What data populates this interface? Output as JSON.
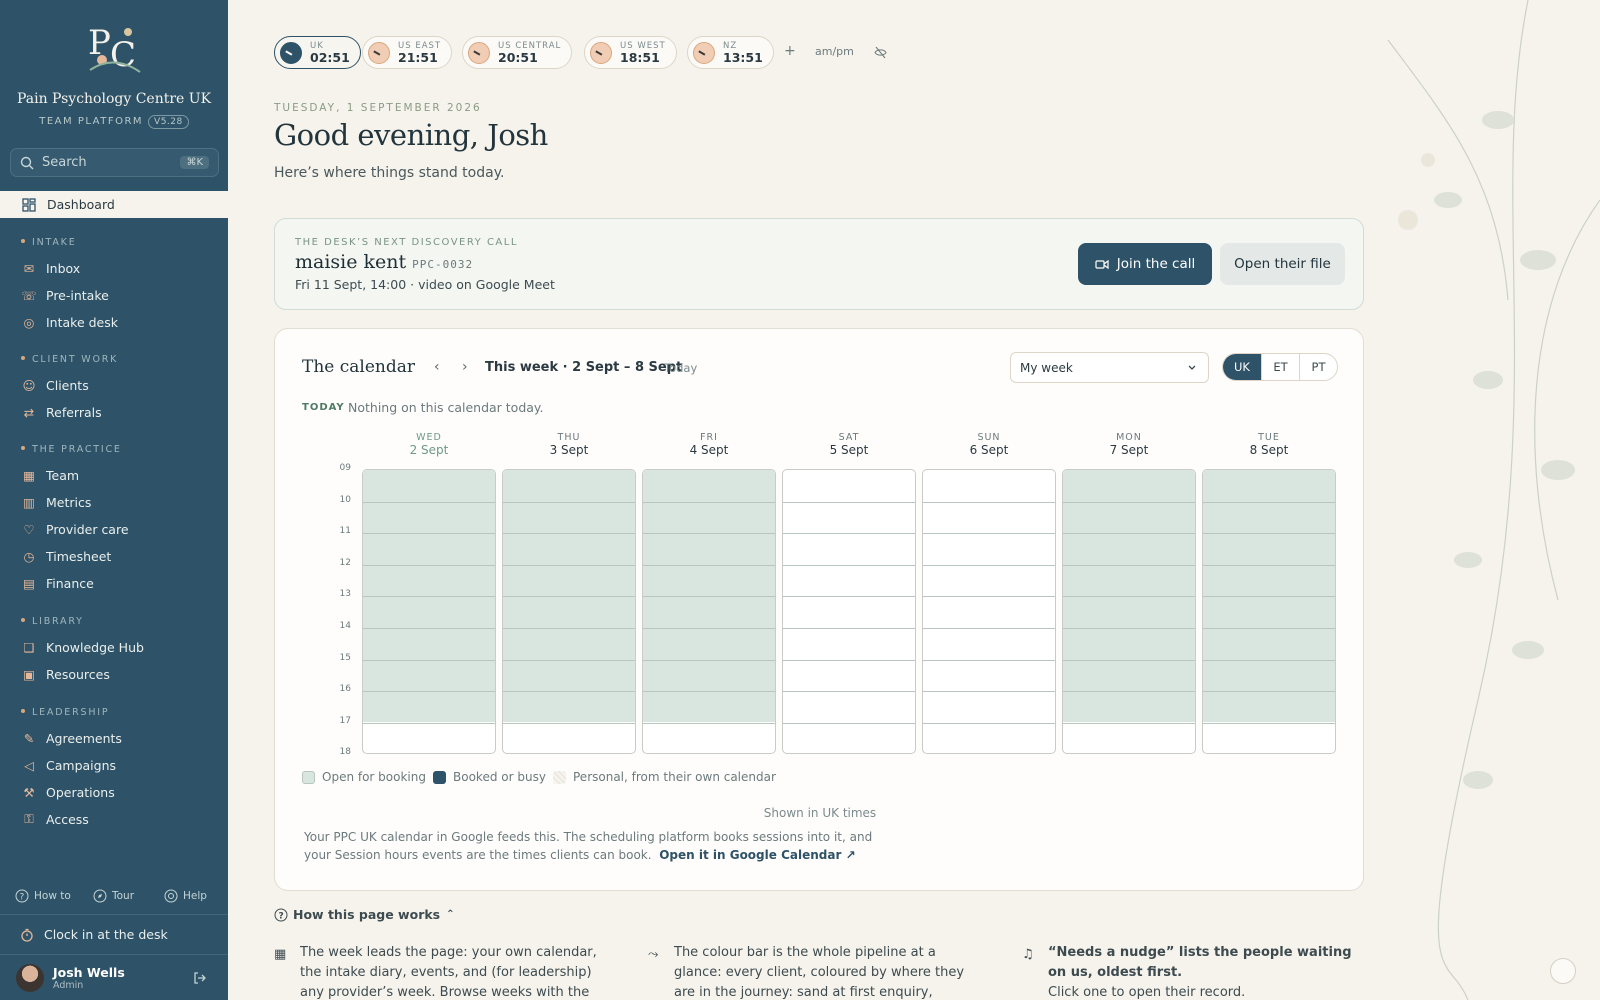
{
  "sidebar": {
    "brand": "Pain Psychology Centre UK",
    "subbrand": "TEAM PLATFORM",
    "version": "V5.28",
    "search": {
      "label": "Search",
      "shortcut": "⌘K"
    },
    "dashboard": "Dashboard",
    "sections": [
      {
        "label": "INTAKE",
        "items": [
          "Inbox",
          "Pre-intake",
          "Intake desk"
        ]
      },
      {
        "label": "CLIENT WORK",
        "items": [
          "Clients",
          "Referrals"
        ]
      },
      {
        "label": "THE PRACTICE",
        "items": [
          "Team",
          "Metrics",
          "Provider care",
          "Timesheet",
          "Finance"
        ]
      },
      {
        "label": "LIBRARY",
        "items": [
          "Knowledge Hub",
          "Resources"
        ]
      },
      {
        "label": "LEADERSHIP",
        "items": [
          "Agreements",
          "Campaigns",
          "Operations",
          "Access"
        ]
      }
    ],
    "footer": {
      "how_to": "How to",
      "tour": "Tour",
      "help": "Help"
    },
    "clock_in": "Clock in at the desk",
    "user": {
      "name": "Josh Wells",
      "role": "Admin"
    }
  },
  "timezones": [
    {
      "label": "UK",
      "time": "02:51"
    },
    {
      "label": "US EAST",
      "time": "21:51"
    },
    {
      "label": "US CENTRAL",
      "time": "20:51"
    },
    {
      "label": "US WEST",
      "time": "18:51"
    },
    {
      "label": "NZ",
      "time": "13:51"
    }
  ],
  "tz_controls": {
    "add": "+",
    "ampm": "am/pm"
  },
  "header": {
    "date": "TUESDAY, 1 SEPTEMBER 2026",
    "greeting": "Good evening, Josh",
    "subtitle": "Here’s where things stand today."
  },
  "next_call": {
    "label": "THE DESK’S NEXT DISCOVERY CALL",
    "name": "maisie kent",
    "ref": "PPC-0032",
    "detail": "Fri 11 Sept, 14:00 · video on Google Meet",
    "join": "Join the call",
    "open": "Open their file"
  },
  "calendar": {
    "title": "The calendar",
    "week": "This week · 2 Sept – 8 Sept",
    "today_btn": "Today",
    "view": "My week",
    "zones": [
      "UK",
      "ET",
      "PT"
    ],
    "active_zone": "UK",
    "today_label": "TODAY",
    "today_text": "Nothing on this calendar today.",
    "days": [
      {
        "name": "WED",
        "date": "2 Sept",
        "open": true,
        "current": true
      },
      {
        "name": "THU",
        "date": "3 Sept",
        "open": true
      },
      {
        "name": "FRI",
        "date": "4 Sept",
        "open": true
      },
      {
        "name": "SAT",
        "date": "5 Sept",
        "open": false
      },
      {
        "name": "SUN",
        "date": "6 Sept",
        "open": false
      },
      {
        "name": "MON",
        "date": "7 Sept",
        "open": true
      },
      {
        "name": "TUE",
        "date": "8 Sept",
        "open": true
      }
    ],
    "hours": [
      "09",
      "10",
      "11",
      "12",
      "13",
      "14",
      "15",
      "16",
      "17",
      "18"
    ],
    "legend": [
      {
        "label": "Open for booking",
        "color": "#d9e6df"
      },
      {
        "label": "Booked or busy",
        "color": "#2e5268"
      },
      {
        "label": "Personal, from their own calendar",
        "color": "#ece9e2"
      }
    ],
    "shown": "Shown in UK times",
    "note": "Your PPC UK calendar in Google feeds this. The scheduling platform books sessions into it, and your Session hours events are the times clients can book.",
    "note_link": "Open it in Google Calendar"
  },
  "how": {
    "title": "How this page works",
    "cols": [
      {
        "text": "The week leads the page: your own calendar, the intake diary, events, and (for leadership) any provider’s week. Browse weeks with the arrows and"
      },
      {
        "text": "The colour bar is the whole pipeline at a glance: every client, coloured by where they are in the journey: sand at first enquiry, warming through"
      },
      {
        "bold": "“Needs a nudge” lists the people waiting on us, oldest first.",
        "text": "Click one to open their record."
      }
    ]
  }
}
